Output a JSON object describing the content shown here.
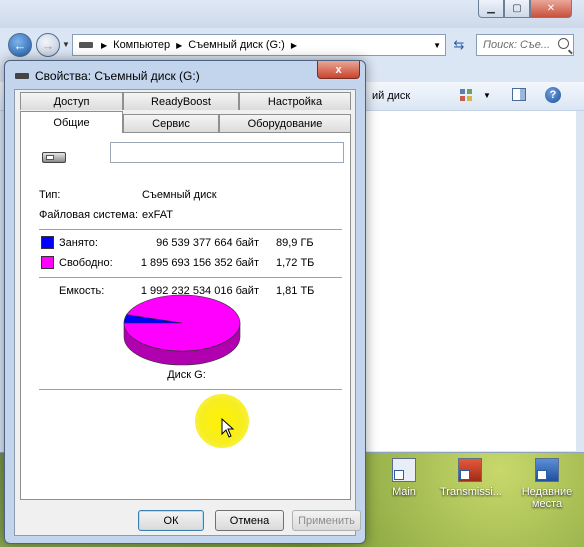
{
  "explorer": {
    "breadcrumbs": [
      "Компьютер",
      "Съемный диск (G:)"
    ],
    "search_placeholder": "Поиск: Съе...",
    "commandbar_text": "ий диск"
  },
  "desktop_icons": [
    {
      "label": "Main"
    },
    {
      "label": "Transmissi..."
    },
    {
      "label": "Недавние места"
    }
  ],
  "dialog": {
    "title": "Свойства: Съемный диск (G:)",
    "close_label": "x",
    "tabs_back": [
      "Доступ",
      "ReadyBoost",
      "Настройка"
    ],
    "tabs_front": [
      "Общие",
      "Сервис",
      "Оборудование"
    ],
    "active_tab": "Общие",
    "name_value": "",
    "type_label": "Тип:",
    "type_value": "Съемный диск",
    "fs_label": "Файловая система:",
    "fs_value": "exFAT",
    "used": {
      "label": "Занято:",
      "bytes": "96 539 377 664 байт",
      "size": "89,9 ГБ",
      "color": "#0000ff"
    },
    "free": {
      "label": "Свободно:",
      "bytes": "1 895 693 156 352 байт",
      "size": "1,72 ТБ",
      "color": "#ff00ff"
    },
    "capacity": {
      "label": "Емкость:",
      "bytes": "1 992 232 534 016 байт",
      "size": "1,81 ТБ"
    },
    "used_fraction": 0.0485,
    "disk_label": "Диск G:",
    "buttons": {
      "ok": "ОК",
      "cancel": "Отмена",
      "apply": "Применить"
    }
  }
}
